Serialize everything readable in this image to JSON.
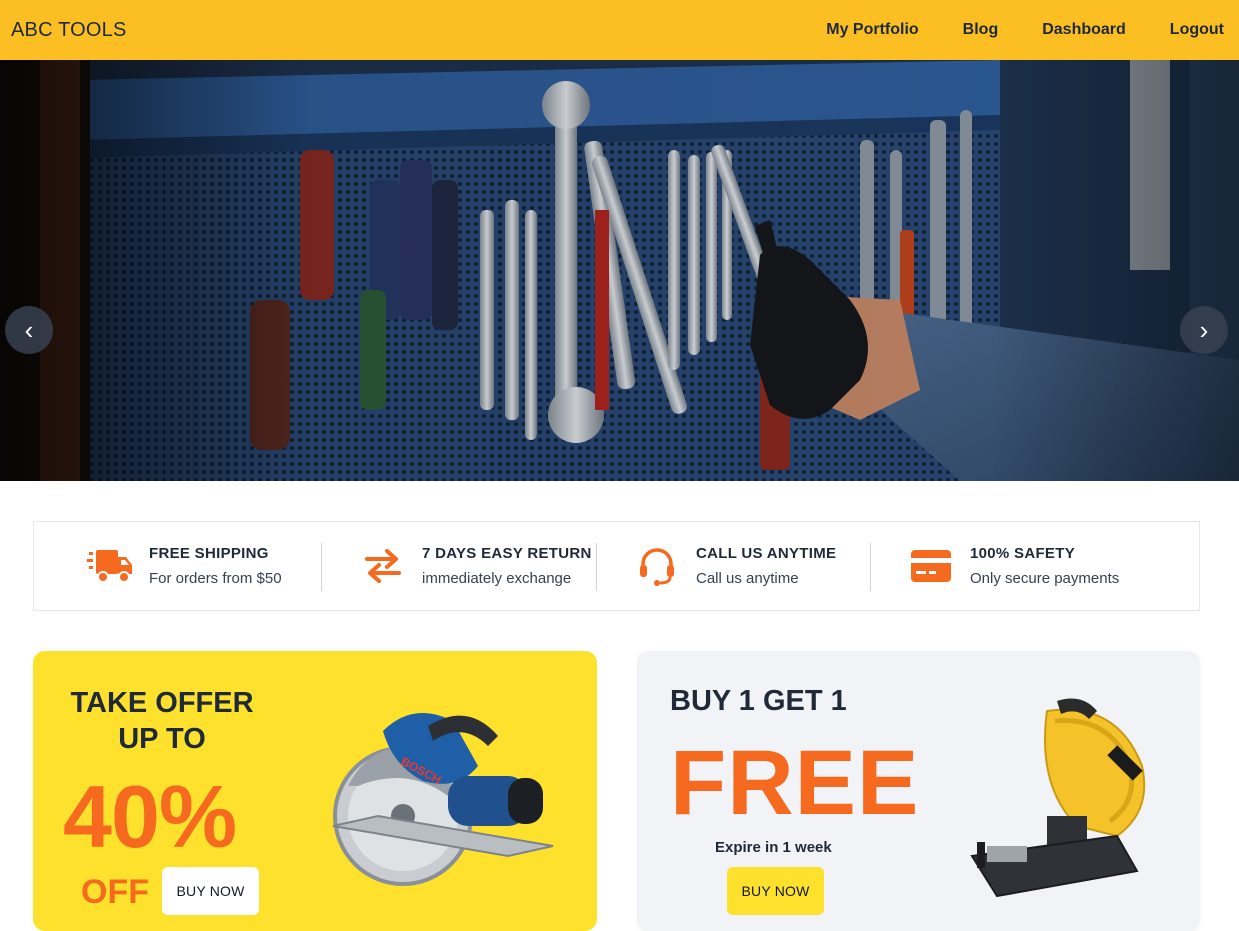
{
  "navbar": {
    "brand": "ABC TOOLS",
    "links": [
      "My Portfolio",
      "Blog",
      "Dashboard",
      "Logout"
    ],
    "background": "#fbbf24"
  },
  "hero": {
    "prev_icon": "chevron-left-icon",
    "next_icon": "chevron-right-icon",
    "prev_glyph": "‹",
    "next_glyph": "›"
  },
  "features": [
    {
      "icon": "truck-icon",
      "title": "FREE SHIPPING",
      "subtitle": "For orders from $50"
    },
    {
      "icon": "exchange-icon",
      "title": "7 DAYS EASY RETURN",
      "subtitle": "immediately exchange"
    },
    {
      "icon": "headset-icon",
      "title": "CALL US ANYTIME",
      "subtitle": "Call us anytime"
    },
    {
      "icon": "credit-card-icon",
      "title": "100% SAFETY",
      "subtitle": "Only secure payments"
    }
  ],
  "promos": {
    "offer": {
      "heading_line1": "TAKE OFFER",
      "heading_line2": "UP TO",
      "percent": "40%",
      "off": "OFF",
      "button": "BUY NOW",
      "background": "#fde12d"
    },
    "bogo": {
      "heading": "BUY 1 GET 1",
      "free": "FREE",
      "expire": "Expire in 1 week",
      "button": "BUY NOW",
      "background": "#f1f3f7"
    }
  },
  "colors": {
    "accent": "#f56a1e",
    "text": "#1f2937"
  }
}
